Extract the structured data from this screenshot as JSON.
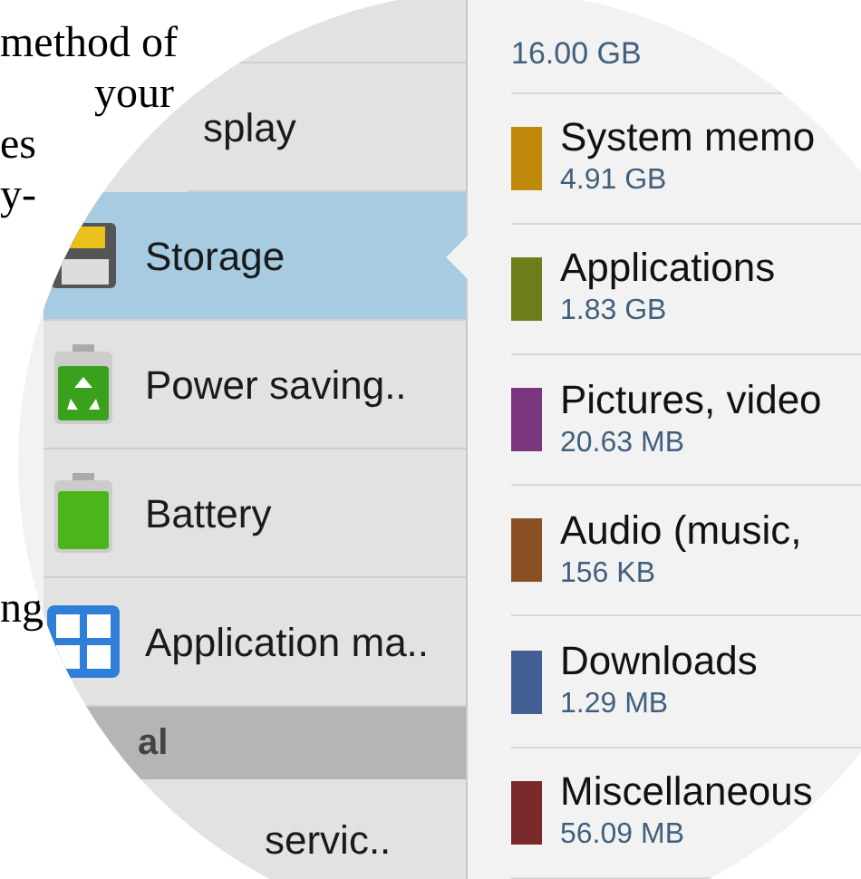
{
  "article_lines": [
    {
      "text": "method of",
      "indent": false
    },
    {
      "text": "your",
      "indent": true
    },
    {
      "text": "es",
      "indent": false
    },
    {
      "text": "y-",
      "indent": false
    },
    {
      "text": "ng",
      "indent": false
    }
  ],
  "settings_list": [
    {
      "label": "splay",
      "kind": "none",
      "selected": false
    },
    {
      "label": "Storage",
      "kind": "storage",
      "selected": true
    },
    {
      "label": "Power saving..",
      "kind": "power",
      "selected": false
    },
    {
      "label": "Battery",
      "kind": "battery",
      "selected": false
    },
    {
      "label": "Application ma..",
      "kind": "apps",
      "selected": false
    }
  ],
  "section_header": "al",
  "last_item": "servic..",
  "storage": {
    "total": "16.00 GB",
    "categories": [
      {
        "name": "System memo",
        "size": "4.91 GB",
        "color": "#bf8a0c"
      },
      {
        "name": "Applications",
        "size": "1.83 GB",
        "color": "#6e7d1a"
      },
      {
        "name": "Pictures, video",
        "size": "20.63 MB",
        "color": "#7a367e"
      },
      {
        "name": "Audio (music,",
        "size": "156 KB",
        "color": "#8a5024"
      },
      {
        "name": "Downloads",
        "size": "1.29 MB",
        "color": "#445e96"
      },
      {
        "name": "Miscellaneous",
        "size": "56.09 MB",
        "color": "#7a2a2a"
      }
    ]
  }
}
